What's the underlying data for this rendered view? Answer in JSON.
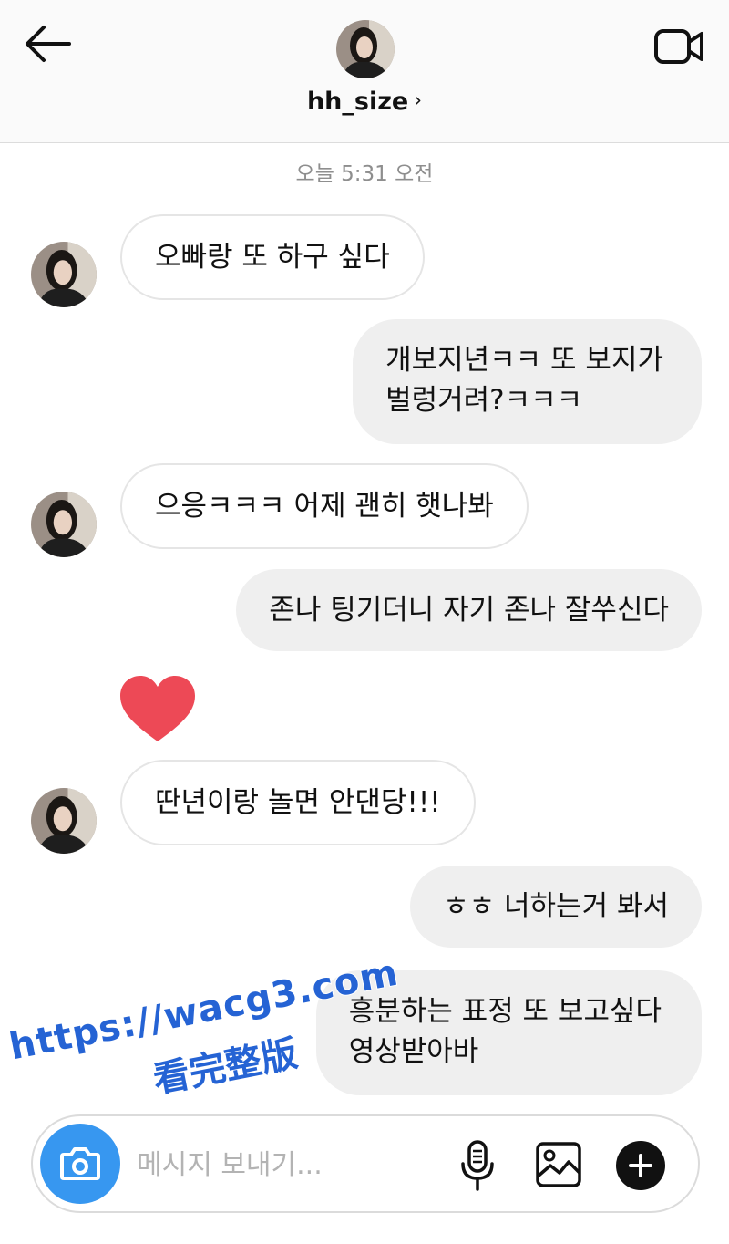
{
  "header": {
    "username": "hh_size",
    "chevron": "›",
    "icons": {
      "back": "arrow-left-icon",
      "video": "video-camera-icon"
    }
  },
  "chat": {
    "timestamp": "오늘 5:31 오전",
    "messages": [
      {
        "sender": "other",
        "lines": [
          "오빠랑 또 하구 싶다"
        ]
      },
      {
        "sender": "me",
        "lines": [
          "개보지년ㅋㅋ 또 보지가",
          "벌렁거려?ㅋㅋㅋ"
        ]
      },
      {
        "sender": "other",
        "lines": [
          "으응ㅋㅋㅋ  어제 괜히 햇나봐"
        ]
      },
      {
        "sender": "me",
        "lines": [
          "존나 팅기더니 자기 존나 잘쑤신다"
        ]
      },
      {
        "sender": "other",
        "reaction": "heart",
        "color": "#ed4956"
      },
      {
        "sender": "other",
        "lines": [
          "딴년이랑 놀면 안댄당!!!"
        ]
      },
      {
        "sender": "me",
        "lines": [
          "ㅎㅎ 너하는거 봐서"
        ]
      },
      {
        "sender": "me",
        "lines": [
          "흥분하는 표정 또 보고싶다",
          "영상받아바"
        ]
      }
    ]
  },
  "watermark": {
    "line1": "https://wacg3.com",
    "line2": "看完整版",
    "color": "#2563d4"
  },
  "composer": {
    "placeholder": "메시지 보내기...",
    "value": "",
    "camera_color": "#3797f0",
    "icons": {
      "camera": "camera-icon",
      "mic": "microphone-icon",
      "gallery": "image-icon",
      "plus": "plus-icon"
    }
  }
}
